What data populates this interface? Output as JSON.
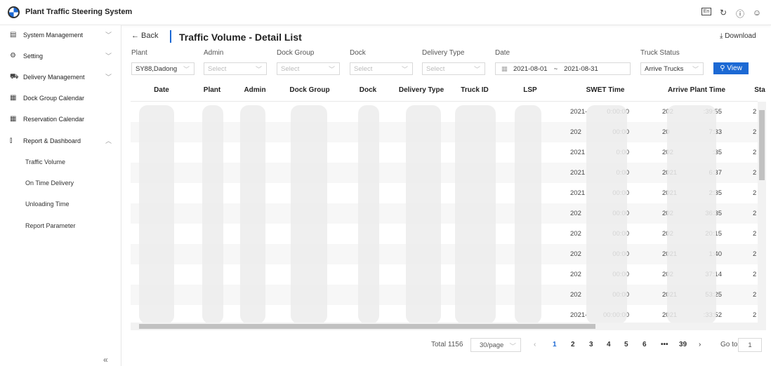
{
  "app": {
    "title": "Plant Traffic Steering System",
    "top_icons": [
      "language-icon",
      "refresh-icon",
      "help-icon",
      "user-icon"
    ]
  },
  "sidebar": {
    "items": [
      {
        "label": "System Management",
        "icon": "system-icon",
        "chevron": "down"
      },
      {
        "label": "Setting",
        "icon": "gear-icon",
        "chevron": "down"
      },
      {
        "label": "Delivery Management",
        "icon": "truck-icon",
        "chevron": "down"
      },
      {
        "label": "Dock Group Calendar",
        "icon": "calendar-icon"
      },
      {
        "label": "Reservation Calendar",
        "icon": "calendar-icon"
      },
      {
        "label": "Report & Dashboard",
        "icon": "chart-icon",
        "chevron": "up"
      }
    ],
    "subitems": [
      "Traffic Volume",
      "On Time Delivery",
      "Unloading Time",
      "Report Parameter"
    ],
    "collapse": "«"
  },
  "header": {
    "back": "← Back",
    "title": "Traffic Volume - Detail List",
    "download": "⤓ Download"
  },
  "filters": {
    "plant": {
      "label": "Plant",
      "value": "SY88,Dadong"
    },
    "admin": {
      "label": "Admin",
      "placeholder": "Select"
    },
    "dock_group": {
      "label": "Dock Group",
      "placeholder": "Select"
    },
    "dock": {
      "label": "Dock",
      "placeholder": "Select"
    },
    "delivery_type": {
      "label": "Delivery Type",
      "placeholder": "Select"
    },
    "date": {
      "label": "Date",
      "start": "2021-08-01",
      "sep": "~",
      "end": "2021-08-31"
    },
    "truck_status": {
      "label": "Truck Status",
      "value": "Arrive Trucks"
    },
    "view": "View"
  },
  "table": {
    "columns": [
      "Date",
      "Plant",
      "Admin",
      "Dock Group",
      "Dock",
      "Delivery Type",
      "Truck ID",
      "LSP",
      "SWET Time",
      "Arrive Plant Time",
      "Sta"
    ],
    "rows": [
      {
        "swet_a": "2021-",
        "swet_b": "0:00:00",
        "arr_a": "202",
        "arr_b": ":39:55",
        "st": "2"
      },
      {
        "swet_a": "202",
        "swet_b": "00:00",
        "arr_a": "20",
        "arr_b": "7:33",
        "st": "2"
      },
      {
        "swet_a": "2021",
        "swet_b": "0:00",
        "arr_a": "202",
        "arr_b": ":35",
        "st": "2"
      },
      {
        "swet_a": "2021",
        "swet_b": "0:00",
        "arr_a": "2021",
        "arr_b": "6:37",
        "st": "2"
      },
      {
        "swet_a": "2021",
        "swet_b": "00:00",
        "arr_a": "2021",
        "arr_b": "2:35",
        "st": "2"
      },
      {
        "swet_a": "202",
        "swet_b": "00:00",
        "arr_a": "202",
        "arr_b": "36:35",
        "st": "2"
      },
      {
        "swet_a": "202",
        "swet_b": "00:00",
        "arr_a": "202",
        "arr_b": "20:15",
        "st": "2"
      },
      {
        "swet_a": "202",
        "swet_b": "00:00",
        "arr_a": "2021",
        "arr_b": "1:40",
        "st": "2"
      },
      {
        "swet_a": "202",
        "swet_b": "00:00",
        "arr_a": "202",
        "arr_b": "37:14",
        "st": "2"
      },
      {
        "swet_a": "202",
        "swet_b": "00:00",
        "arr_a": "2021",
        "arr_b": "53:25",
        "st": "2"
      },
      {
        "swet_a": "2021-",
        "swet_b": "00:00:00",
        "arr_a": "2021",
        "arr_b": ":33:52",
        "st": "2"
      }
    ]
  },
  "pagination": {
    "total": "Total 1156",
    "page_size": "30/page",
    "prev": "‹",
    "pages": [
      "1",
      "2",
      "3",
      "4",
      "5",
      "6",
      "•••",
      "39"
    ],
    "current": "1",
    "next": "›",
    "goto_label": "Go to",
    "goto_value": "1"
  },
  "colors": {
    "accent": "#1c69d4"
  }
}
